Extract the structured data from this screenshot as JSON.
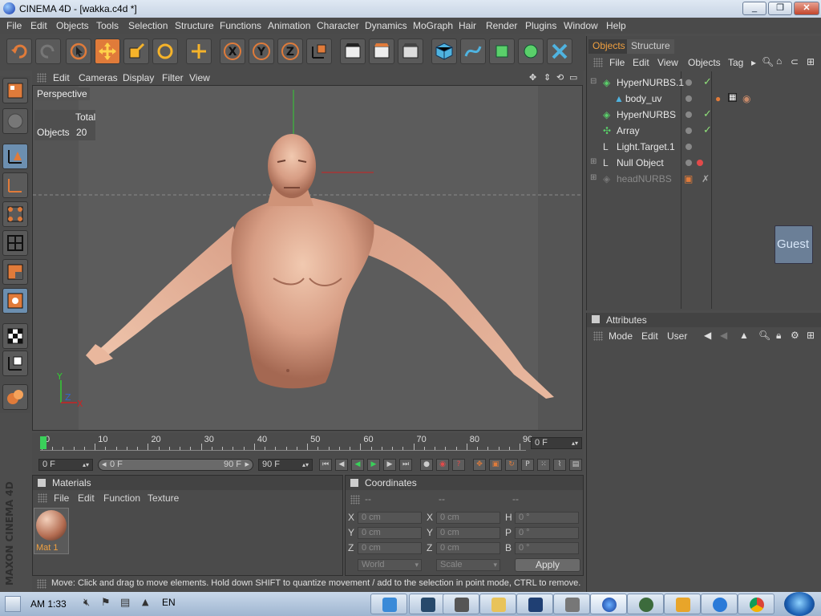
{
  "window": {
    "title": "CINEMA 4D - [wakka.c4d *]"
  },
  "menubar": [
    "File",
    "Edit",
    "Objects",
    "Tools",
    "Selection",
    "Structure",
    "Functions",
    "Animation",
    "Character",
    "Dynamics",
    "MoGraph",
    "Hair",
    "Render",
    "Plugins",
    "Window",
    "Help"
  ],
  "viewport": {
    "menu": [
      "Edit",
      "Cameras",
      "Display",
      "Filter",
      "View"
    ],
    "label": "Perspective",
    "stats": {
      "header": "Total",
      "row_label": "Objects",
      "row_value": "20"
    },
    "axis_labels": {
      "x": "X",
      "y": "Y",
      "z": "Z"
    }
  },
  "objects_panel": {
    "tabs": [
      "Objects",
      "Structure"
    ],
    "menu": [
      "File",
      "Edit",
      "View",
      "Objects",
      "Tag"
    ],
    "items": [
      {
        "name": "HyperNURBS.1",
        "indent": 0,
        "checked": true,
        "icon": "hypernurbs-icon"
      },
      {
        "name": "body_uv",
        "indent": 1,
        "checked": false,
        "icon": "polygon-object-icon"
      },
      {
        "name": "HyperNURBS",
        "indent": 0,
        "checked": true,
        "icon": "hypernurbs-icon"
      },
      {
        "name": "Array",
        "indent": 0,
        "checked": true,
        "icon": "array-icon"
      },
      {
        "name": "Light.Target.1",
        "indent": 0,
        "checked": false,
        "icon": "light-target-icon"
      },
      {
        "name": "Null Object",
        "indent": 0,
        "checked": false,
        "icon": "null-object-icon"
      },
      {
        "name": "headNURBS",
        "indent": 0,
        "checked": false,
        "icon": "hypernurbs-icon",
        "disabled": true
      }
    ],
    "guest_label": "Guest"
  },
  "attributes_panel": {
    "title": "Attributes",
    "menu": [
      "Mode",
      "Edit",
      "User"
    ]
  },
  "timeline": {
    "ticks": [
      "0",
      "10",
      "20",
      "30",
      "40",
      "50",
      "60",
      "70",
      "80",
      "90"
    ],
    "current_frame": "0 F",
    "start_field": "0 F",
    "range_start": "0 F",
    "range_end": "90 F",
    "end_field": "90 F"
  },
  "materials": {
    "title": "Materials",
    "menu": [
      "File",
      "Edit",
      "Function",
      "Texture"
    ],
    "items": [
      {
        "name": "Mat 1"
      }
    ]
  },
  "coordinates": {
    "title": "Coordinates",
    "column_headers": [
      "--",
      "--",
      "--"
    ],
    "rows": [
      {
        "l1": "X",
        "v1": "0 cm",
        "l2": "X",
        "v2": "0 cm",
        "l3": "H",
        "v3": "0 °"
      },
      {
        "l1": "Y",
        "v1": "0 cm",
        "l2": "Y",
        "v2": "0 cm",
        "l3": "P",
        "v3": "0 °"
      },
      {
        "l1": "Z",
        "v1": "0 cm",
        "l2": "Z",
        "v2": "0 cm",
        "l3": "B",
        "v3": "0 °"
      }
    ],
    "space_select": "World",
    "mode_select": "Scale",
    "apply_label": "Apply"
  },
  "statusbar": {
    "text": "Move: Click and drag to move elements. Hold down SHIFT to quantize movement / add to the selection in point mode, CTRL to remove."
  },
  "branding": {
    "logo_text": "MAXON CINEMA 4D"
  },
  "taskbar": {
    "time": "AM 1:33",
    "language": "EN"
  },
  "colors": {
    "accent": "#e07b3a",
    "active_tab": "#f0a040",
    "selected_tool": "#6c8fb0"
  }
}
